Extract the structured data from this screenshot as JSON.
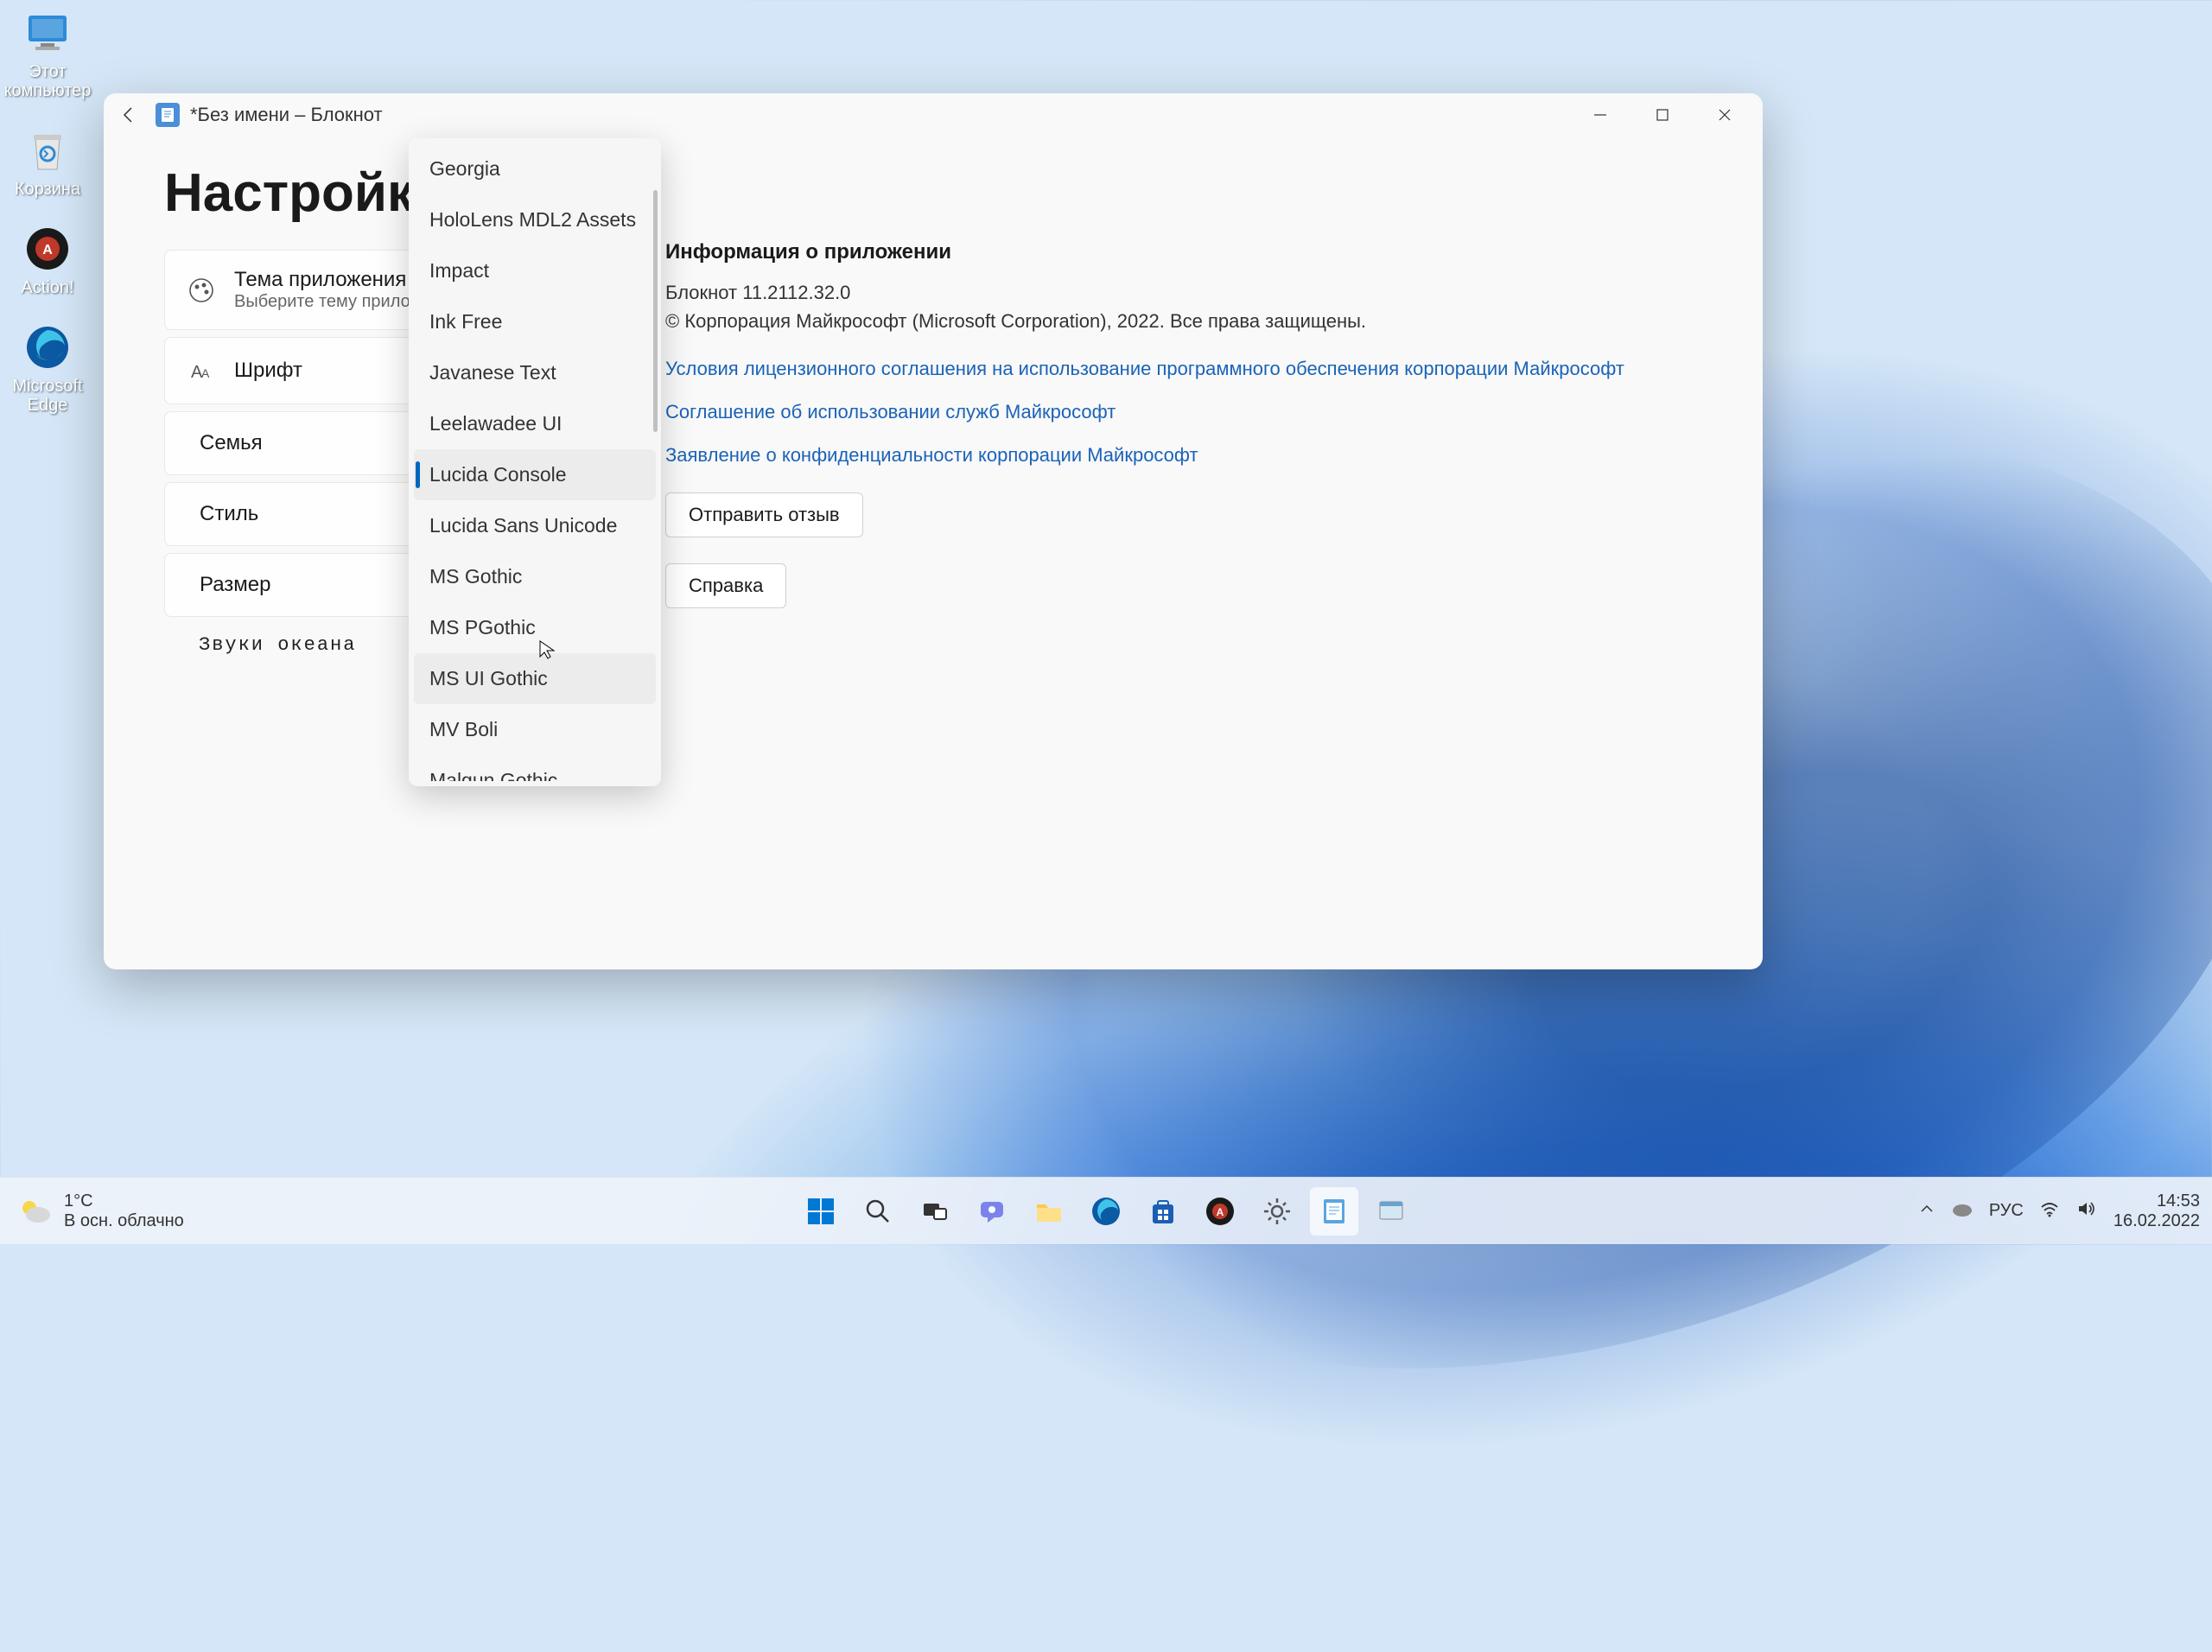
{
  "desktop": {
    "icons": [
      {
        "label": "Этот\nкомпьютер"
      },
      {
        "label": "Корзина"
      },
      {
        "label": "Action!"
      },
      {
        "label": "Microsoft\nEdge"
      }
    ]
  },
  "window": {
    "title": "*Без имени – Блокнот",
    "page_title": "Настройки",
    "settings": {
      "theme": {
        "title": "Тема приложения",
        "subtitle": "Выберите тему прилож"
      },
      "font": {
        "title": "Шрифт"
      },
      "family": {
        "label": "Семья"
      },
      "style": {
        "label": "Стиль"
      },
      "size": {
        "label": "Размер"
      },
      "preview": "Звуки океана"
    },
    "info": {
      "heading": "Информация о приложении",
      "line1": "Блокнот 11.2112.32.0",
      "line2": "© Корпорация Майкрософт (Microsoft Corporation), 2022. Все права защищены.",
      "link1": "Условия лицензионного соглашения на использование программного обеспечения корпорации Майкрософт",
      "link2": "Соглашение об использовании служб Майкрософт",
      "link3": "Заявление о конфиденциальности корпорации Майкрософт",
      "btn_feedback": "Отправить отзыв",
      "btn_help": "Справка"
    }
  },
  "font_dropdown": {
    "items": [
      "Georgia",
      "HoloLens MDL2 Assets",
      "Impact",
      "Ink Free",
      "Javanese Text",
      "Leelawadee UI",
      "Lucida Console",
      "Lucida Sans Unicode",
      "MS Gothic",
      "MS PGothic",
      "MS UI Gothic",
      "MV Boli",
      "Malgun Gothic"
    ],
    "selected": "Lucida Console",
    "hovered": "MS UI Gothic"
  },
  "taskbar": {
    "weather": {
      "temp": "1°C",
      "desc": "В осн. облачно"
    },
    "tray": {
      "lang": "РУС",
      "time": "14:53",
      "date": "16.02.2022"
    }
  }
}
